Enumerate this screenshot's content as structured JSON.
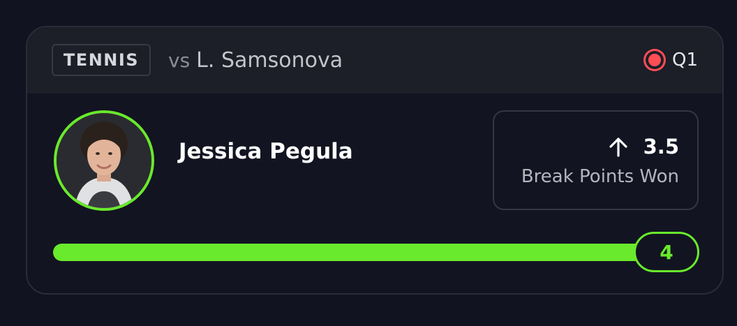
{
  "card": {
    "sport": "TENNIS",
    "opponent_prefix": "vs",
    "opponent": "L. Samsonova",
    "period": "Q1",
    "player_name": "Jessica Pegula",
    "stat": {
      "direction_icon": "arrow-up-icon",
      "line": "3.5",
      "label": "Break Points Won"
    },
    "result": {
      "value": "4",
      "progress_fraction": 1.0
    },
    "colors": {
      "accent": "#69ea2c",
      "live": "#ff4e55"
    }
  }
}
